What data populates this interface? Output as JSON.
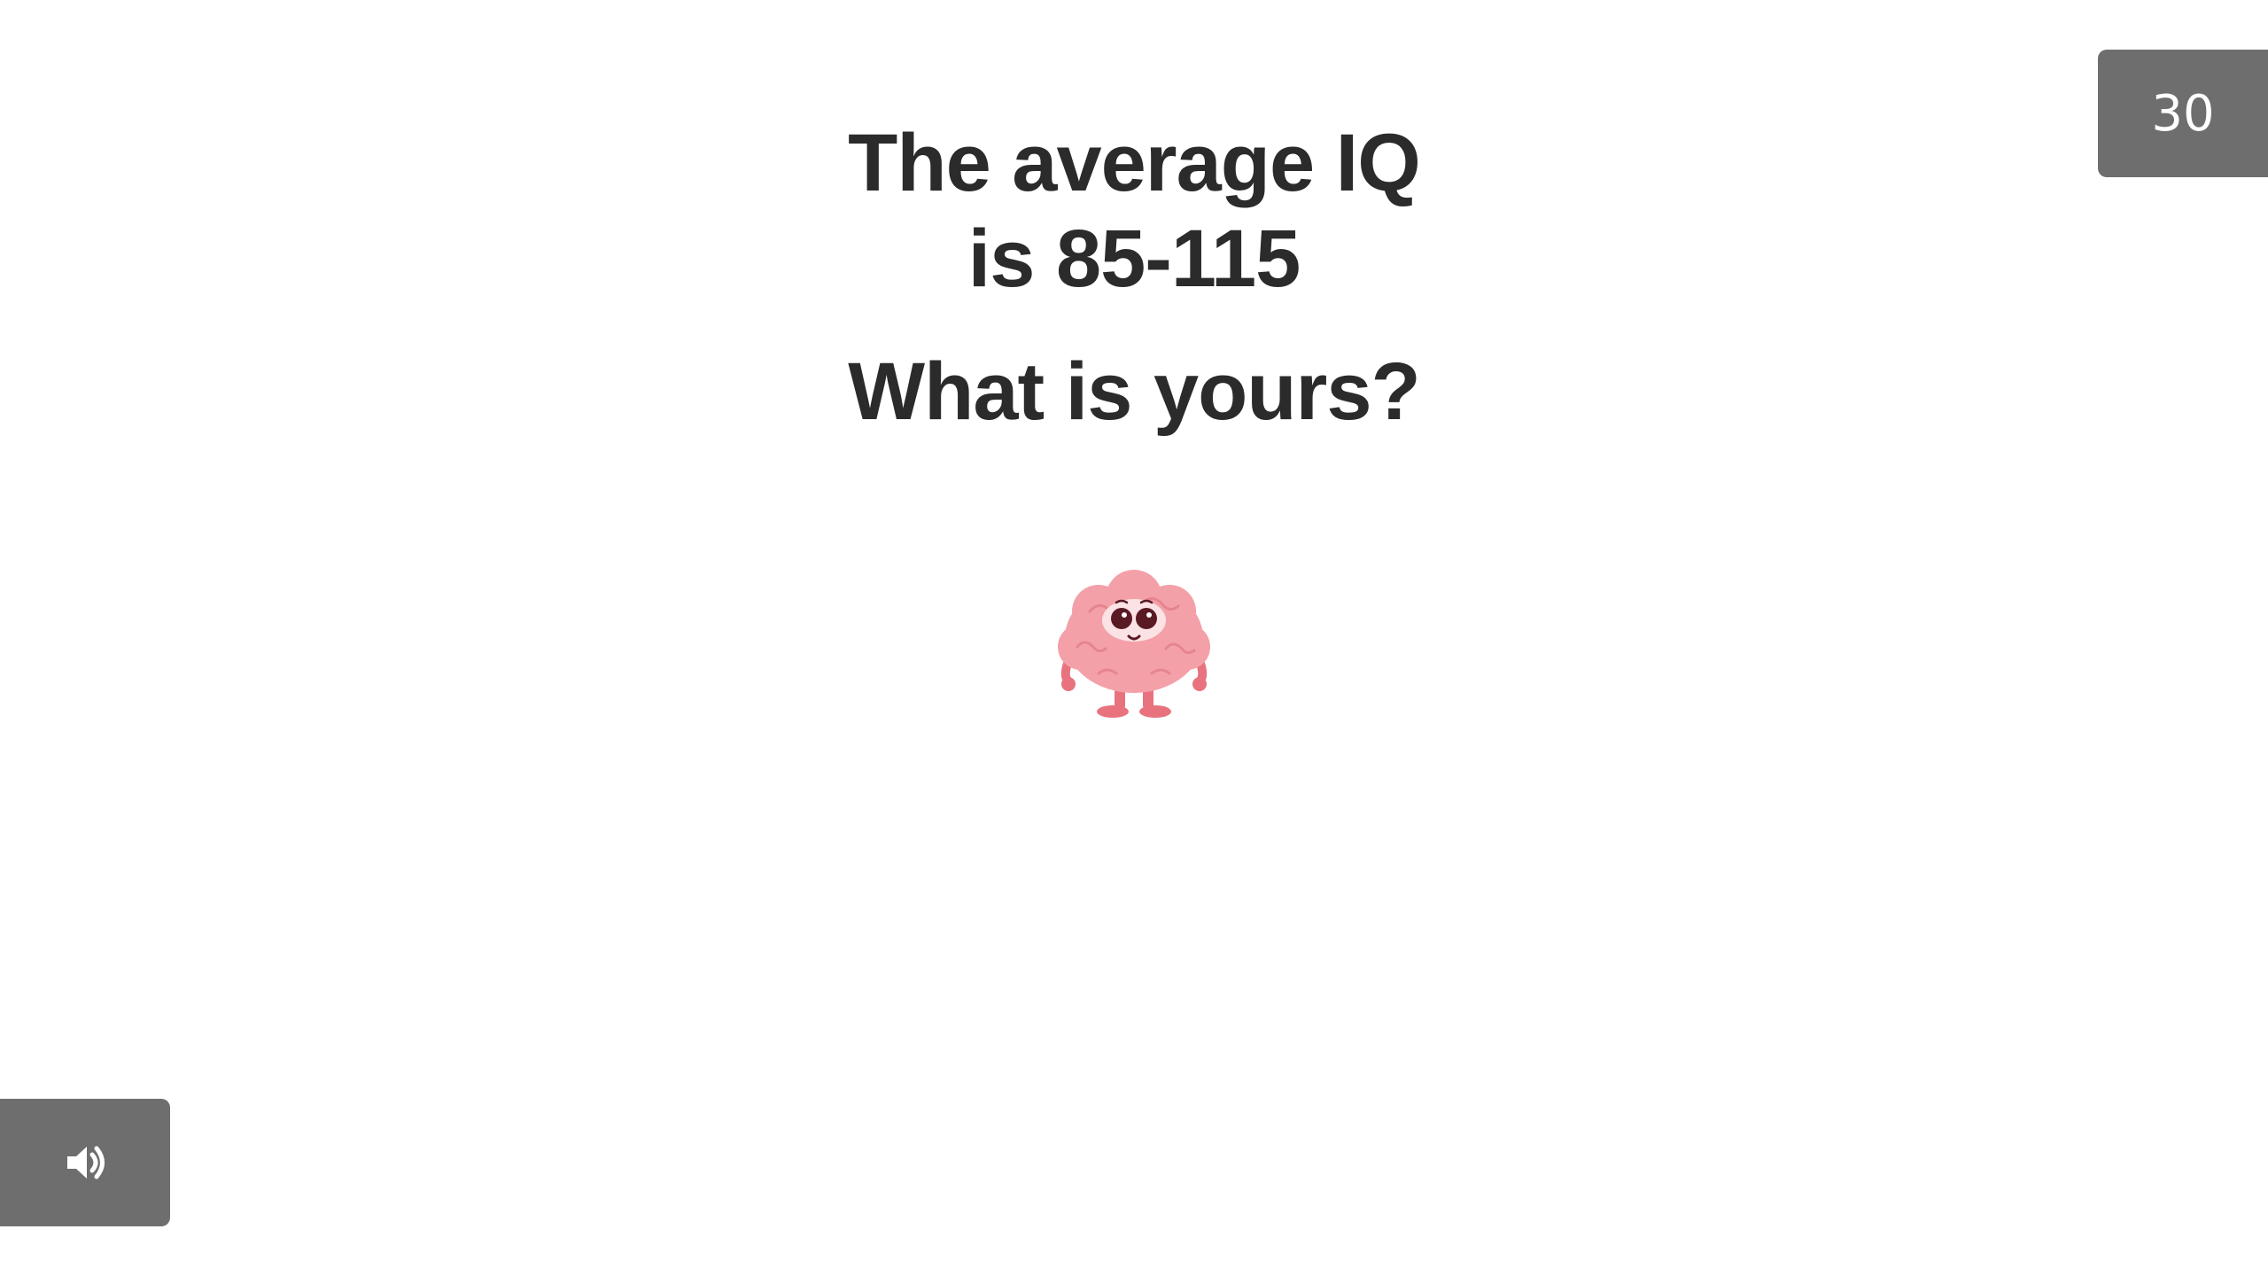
{
  "headline": {
    "line1": "The average IQ",
    "line2_prefix": "is ",
    "line2_value": "85-115"
  },
  "question": "What is yours?",
  "timer": {
    "value": "30"
  },
  "illustration": {
    "icon": "brain-mascot-icon"
  },
  "controls": {
    "sound_icon": "speaker-volume-icon"
  },
  "colors": {
    "text": "#2b2b2b",
    "badge_bg": "#6e6e6e",
    "brain_pink": "#f4a0a8",
    "brain_dark_pink": "#e8737f"
  }
}
